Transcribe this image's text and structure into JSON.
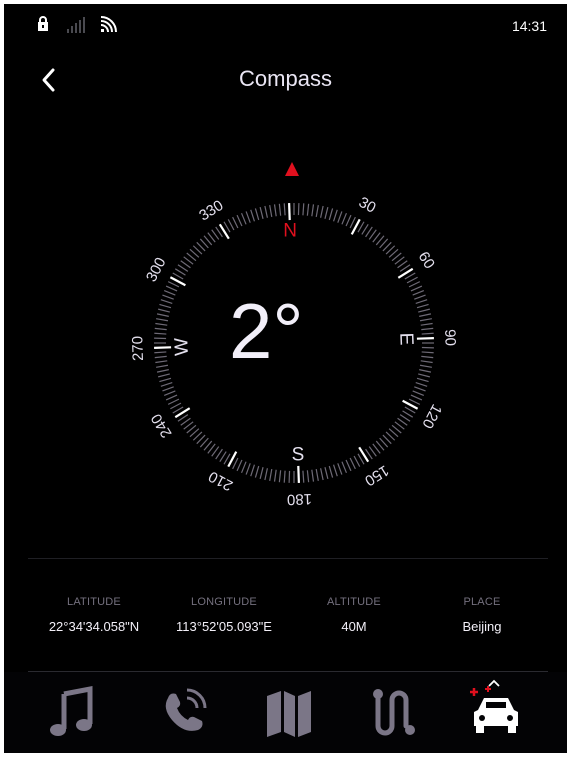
{
  "status_bar": {
    "time": "14:31"
  },
  "header": {
    "title": "Compass"
  },
  "compass": {
    "heading": "2°",
    "heading_degrees": 2,
    "cardinals": {
      "north": "N",
      "east": "E",
      "south": "S",
      "west": "W"
    },
    "degree_labels": [
      "30",
      "60",
      "90",
      "120",
      "150",
      "180",
      "210",
      "240",
      "270",
      "300",
      "330"
    ],
    "north_color": "#e0101e"
  },
  "info": [
    {
      "label": "LATITUDE",
      "value": "22°34'34.058\"N"
    },
    {
      "label": "LONGITUDE",
      "value": "113°52'05.093\"E"
    },
    {
      "label": "ALTITUDE",
      "value": "40M"
    },
    {
      "label": "PLACE",
      "value": "Beijing"
    }
  ],
  "dock": {
    "items": [
      "music-icon",
      "phone-icon",
      "map-icon",
      "route-icon",
      "car-icon"
    ],
    "icon_color": "#7b7687",
    "active_color": "#ffffff",
    "accent_color": "#e0101e"
  }
}
